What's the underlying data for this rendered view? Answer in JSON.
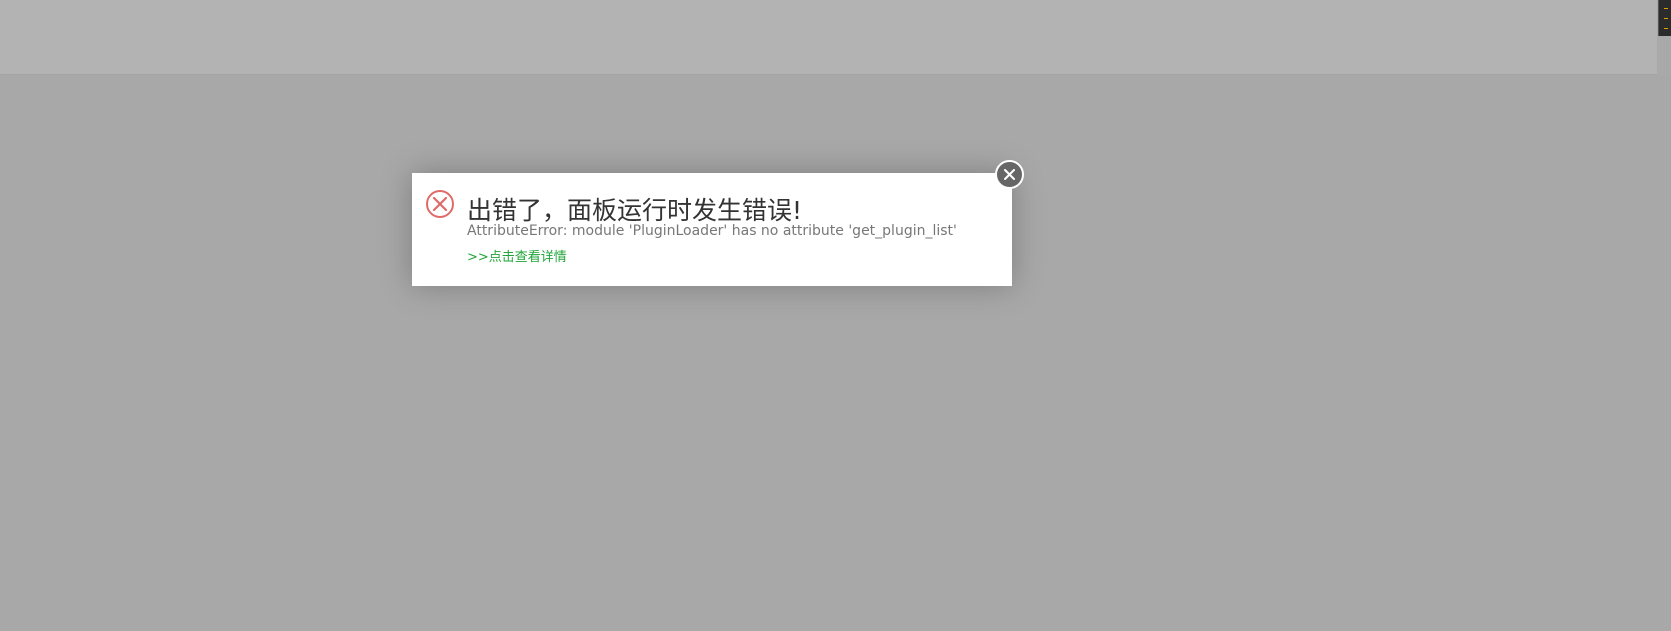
{
  "dialog": {
    "title": "出错了，面板运行时发生错误!",
    "message": "AttributeError: module 'PluginLoader' has no attribute 'get_plugin_list'",
    "details_link": ">>点击查看详情",
    "icon": "error-circle-x-icon",
    "close_icon": "close-icon"
  },
  "colors": {
    "error_icon": "#e06b6b",
    "link": "#20a53a",
    "overlay": "#a8a8a8",
    "dialog_bg": "#ffffff"
  }
}
